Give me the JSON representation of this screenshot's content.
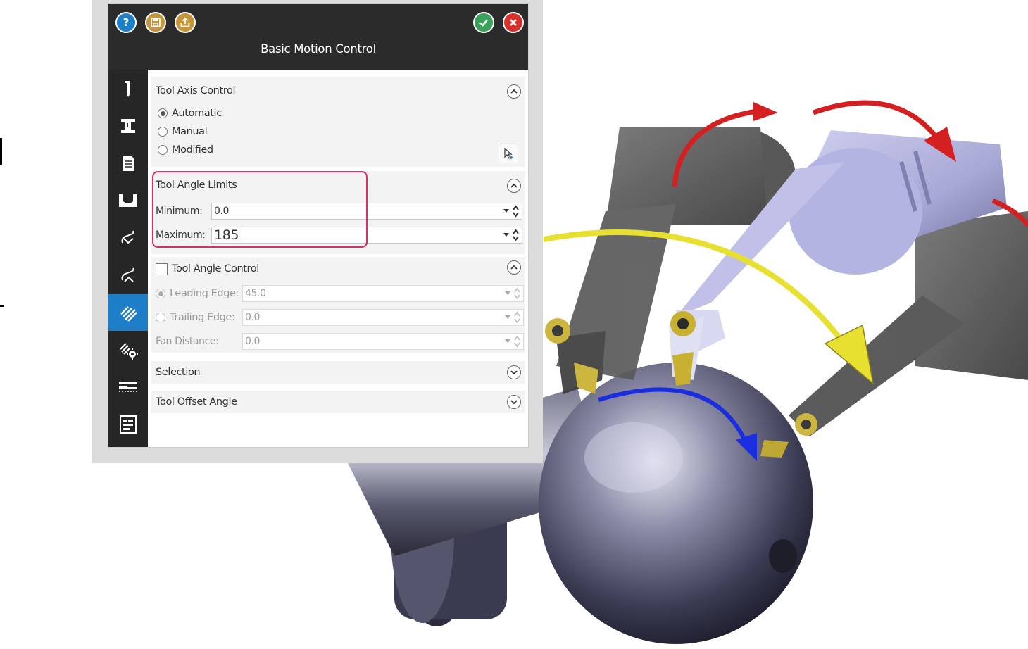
{
  "panel": {
    "title": "Basic Motion Control",
    "buttons": {
      "help": "help-icon",
      "save": "save-icon",
      "export": "export-icon",
      "ok": "check-icon",
      "cancel": "close-icon"
    }
  },
  "sidebar": {
    "items": [
      {
        "icon": "tool-icon",
        "active": false
      },
      {
        "icon": "holder-icon",
        "active": false
      },
      {
        "icon": "document-icon",
        "active": false
      },
      {
        "icon": "geometry-icon",
        "active": false
      },
      {
        "icon": "entry-link-icon",
        "active": false
      },
      {
        "icon": "exit-link-icon",
        "active": false
      },
      {
        "icon": "motion-control-icon",
        "active": true
      },
      {
        "icon": "motion-settings-icon",
        "active": false
      },
      {
        "icon": "cut-pattern-icon",
        "active": false
      },
      {
        "icon": "report-icon",
        "active": false
      }
    ]
  },
  "tool_axis_control": {
    "title": "Tool Axis Control",
    "options": [
      "Automatic",
      "Manual",
      "Modified"
    ],
    "selected": "Automatic"
  },
  "tool_angle_limits": {
    "title": "Tool Angle Limits",
    "minimum_label": "Minimum:",
    "minimum_value": "0.0",
    "maximum_label": "Maximum:",
    "maximum_value": "185"
  },
  "tool_angle_control": {
    "title": "Tool Angle Control",
    "checked": false,
    "leading_edge_label": "Leading Edge:",
    "leading_edge_value": "45.0",
    "trailing_edge_label": "Trailing Edge:",
    "trailing_edge_value": "0.0",
    "fan_distance_label": "Fan Distance:",
    "fan_distance_value": "0.0"
  },
  "selection": {
    "title": "Selection"
  },
  "tool_offset_angle": {
    "title": "Tool Offset Angle"
  },
  "colors": {
    "titlebar": "#2b2b2b",
    "sidebar": "#262626",
    "active_item": "#1e7ec8",
    "highlight_box": "#d6306a",
    "help": "#1e7ec8",
    "save": "#c8953a",
    "ok": "#3aa05a",
    "cancel": "#d9302c"
  }
}
